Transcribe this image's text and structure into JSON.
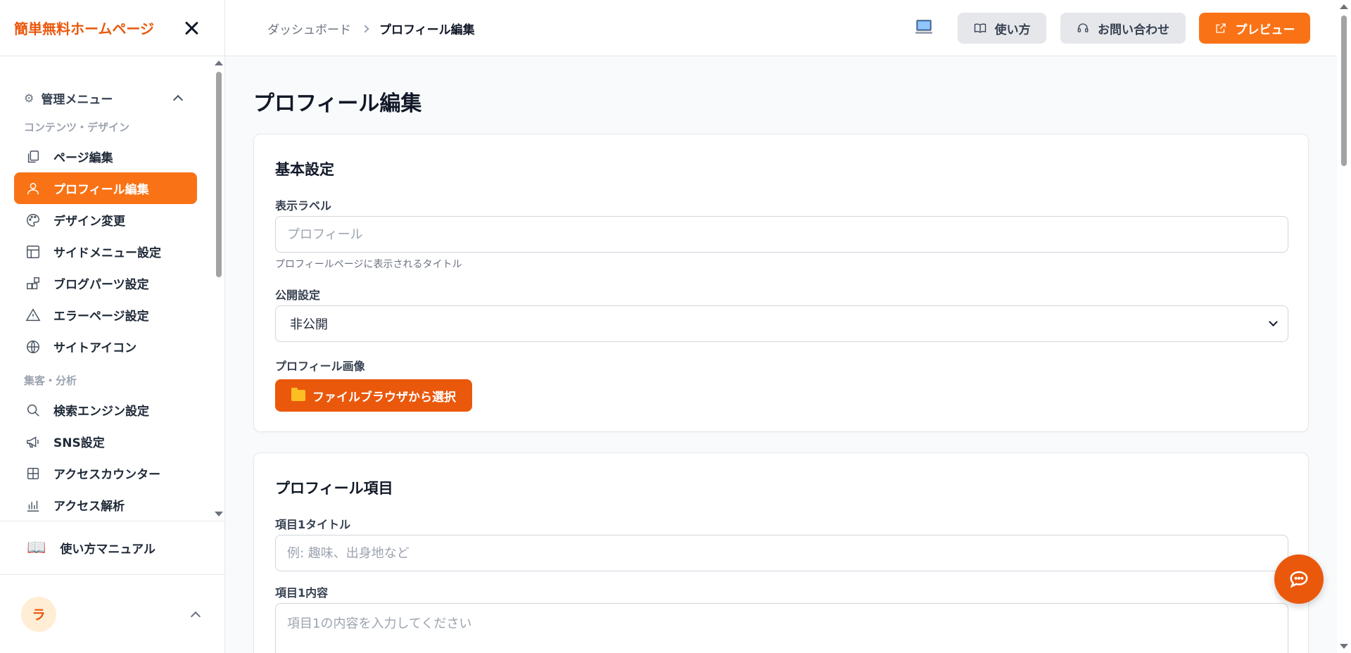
{
  "sidebar": {
    "brand": "簡単無料ホームページ",
    "menu_head": "管理メニュー",
    "sections": [
      {
        "label": "コンテンツ・デザイン",
        "items": [
          {
            "label": "ページ編集",
            "icon": "copy-icon"
          },
          {
            "label": "プロフィール編集",
            "icon": "user-icon",
            "active": true
          },
          {
            "label": "デザイン変更",
            "icon": "palette-icon"
          },
          {
            "label": "サイドメニュー設定",
            "icon": "layout-icon"
          },
          {
            "label": "ブログパーツ設定",
            "icon": "blocks-icon"
          },
          {
            "label": "エラーページ設定",
            "icon": "alert-triangle-icon"
          },
          {
            "label": "サイトアイコン",
            "icon": "globe-icon"
          }
        ]
      },
      {
        "label": "集客・分析",
        "items": [
          {
            "label": "検索エンジン設定",
            "icon": "search-icon"
          },
          {
            "label": "SNS設定",
            "icon": "megaphone-icon"
          },
          {
            "label": "アクセスカウンター",
            "icon": "grid-icon"
          },
          {
            "label": "アクセス解析",
            "icon": "bar-chart-icon"
          }
        ]
      }
    ],
    "manual": "使い方マニュアル",
    "avatar_initial": "ラ"
  },
  "topbar": {
    "breadcrumb": [
      "ダッシュボード",
      "プロフィール編集"
    ],
    "buttons": {
      "howto": "使い方",
      "contact": "お問い合わせ",
      "preview": "プレビュー"
    }
  },
  "main": {
    "title": "プロフィール編集",
    "basic": {
      "title": "基本設定",
      "display_label": "表示ラベル",
      "display_placeholder": "プロフィール",
      "display_hint": "プロフィールページに表示されるタイトル",
      "visibility_label": "公開設定",
      "visibility_value": "非公開",
      "image_label": "プロフィール画像",
      "file_button": "ファイルブラウザから選択"
    },
    "items": {
      "title": "プロフィール項目",
      "item1_title_label": "項目1タイトル",
      "item1_title_placeholder": "例: 趣味、出身地など",
      "item1_content_label": "項目1内容",
      "item1_content_placeholder": "項目1の内容を入力してください"
    }
  },
  "colors": {
    "accent": "#f97316",
    "accent_dark": "#ea580c"
  }
}
